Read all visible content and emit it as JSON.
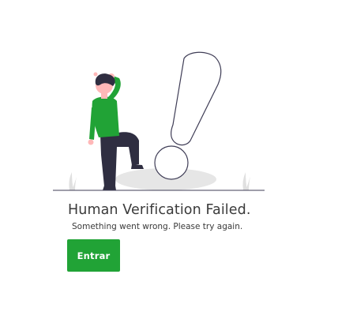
{
  "heading": "Human Verification Failed.",
  "message": "Something went wrong. Please try again.",
  "action": {
    "label": "Entrar"
  },
  "illustration": {
    "subject": "person-leaning-on-exclamation-mark",
    "icon": "exclamation-mark-icon"
  },
  "colors": {
    "accent": "#21a336",
    "shirt": "#21a336",
    "pants": "#2f2e41",
    "ground_shadow": "#e6e6e6",
    "text": "#3a3a3a"
  }
}
